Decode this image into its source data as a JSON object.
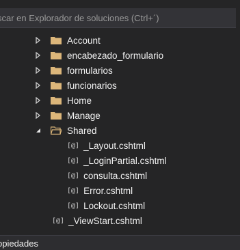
{
  "search": {
    "placeholder": "scar en Explorador de soluciones (Ctrl+´)"
  },
  "tree": {
    "items": [
      {
        "label": "Account",
        "type": "folder",
        "expanded": false
      },
      {
        "label": "encabezado_formulario",
        "type": "folder",
        "expanded": false
      },
      {
        "label": "formularios",
        "type": "folder",
        "expanded": false
      },
      {
        "label": "funcionarios",
        "type": "folder",
        "expanded": false
      },
      {
        "label": "Home",
        "type": "folder",
        "expanded": false
      },
      {
        "label": "Manage",
        "type": "folder",
        "expanded": false
      },
      {
        "label": "Shared",
        "type": "folder",
        "expanded": true
      },
      {
        "label": "_Layout.cshtml",
        "type": "file",
        "icon": "[@]"
      },
      {
        "label": "_LoginPartial.cshtml",
        "type": "file",
        "icon": "[@]"
      },
      {
        "label": "consulta.cshtml",
        "type": "file",
        "icon": "[@]"
      },
      {
        "label": "Error.cshtml",
        "type": "file",
        "icon": "[@]"
      },
      {
        "label": "Lockout.cshtml",
        "type": "file",
        "icon": "[@]"
      },
      {
        "label": "_ViewStart.cshtml",
        "type": "file",
        "icon": "[@]"
      }
    ]
  },
  "footer": {
    "label": "opiedades"
  },
  "colors": {
    "background": "#252526",
    "search_bg": "#333337",
    "folder": "#dcb67a",
    "text": "#f1f1f1"
  },
  "icons": {
    "collapsed_arrow": "triangle-right-icon",
    "expanded_arrow": "triangle-down-icon",
    "folder": "folder-icon",
    "open_folder": "folder-open-icon",
    "razor_file": "razor-file-icon"
  }
}
